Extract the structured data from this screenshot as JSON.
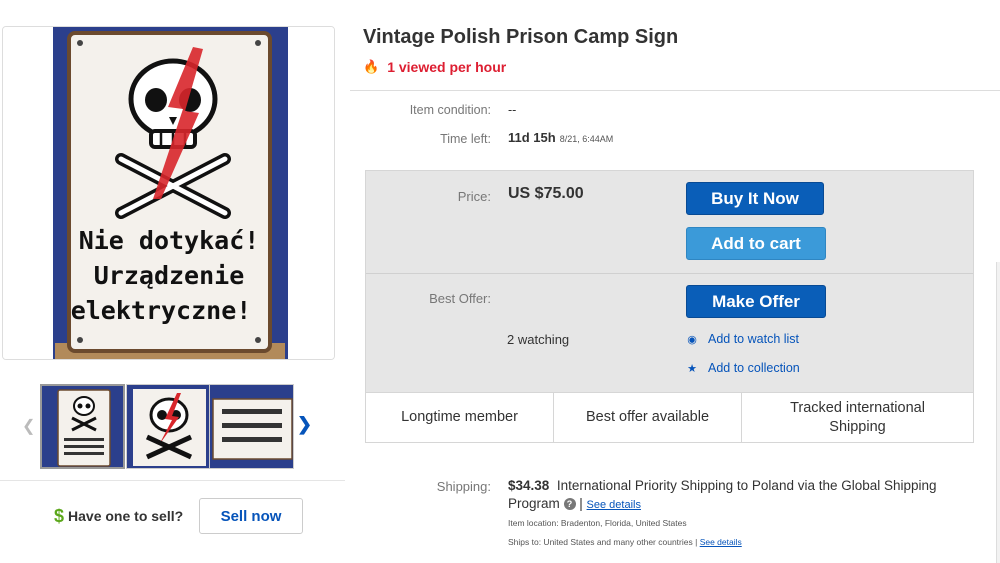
{
  "item": {
    "title": "Vintage Polish Prison Camp Sign",
    "viewed": "1 viewed per hour",
    "sign_text": [
      "Nie dotykać!",
      "Urządzenie",
      "elektryczne!"
    ]
  },
  "details": {
    "condition_label": "Item condition:",
    "condition_value": "--",
    "time_label": "Time left:",
    "time_value": "11d 15h",
    "time_date": "8/21, 6:44AM"
  },
  "buy_box": {
    "price_label": "Price:",
    "price_value": "US $75.00",
    "buy_now": "Buy It Now",
    "add_to_cart": "Add to cart",
    "best_offer_label": "Best Offer:",
    "make_offer": "Make Offer",
    "watching": "2 watching",
    "watch_list": "Add to watch list",
    "collection": "Add to collection",
    "features": [
      "Longtime member",
      "Best offer available",
      "Tracked international Shipping"
    ]
  },
  "shipping": {
    "label": "Shipping:",
    "cost": "$34.38",
    "service": "International Priority Shipping to Poland  via the Global Shipping Program",
    "see_details": "See details",
    "location": "Item location:  Bradenton, Florida, United States",
    "ships_to": "Ships to:  United States and many other countries |",
    "ships_see_details": "See details"
  },
  "sell": {
    "dollar": "$",
    "have_one": "Have one to sell?",
    "sell_now": "Sell now"
  },
  "icons": {
    "flame": "flame-icon",
    "eye": "eye-icon",
    "star": "star-icon",
    "question": "question-icon",
    "chevron_left": "chevron-left-icon",
    "chevron_right": "chevron-right-icon"
  },
  "colors": {
    "accent_blue": "#0a5eb8",
    "light_blue": "#3b9ad9",
    "alert_red": "#dd1e31",
    "dollar_green": "#5ba71b",
    "sign_background": "#2b3f8c"
  }
}
